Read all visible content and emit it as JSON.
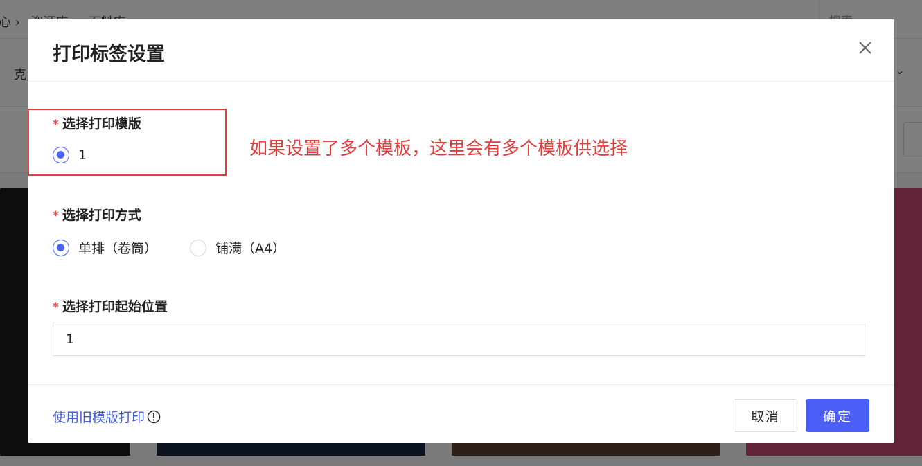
{
  "background": {
    "breadcrumb": [
      "心 ›",
      "资源库 ›",
      "面料库"
    ],
    "search_placeholder": "搜索",
    "toolbar_text": "克",
    "card_colors": [
      "#1a1a1a",
      "#14233f",
      "#5a4030",
      "#c4456e"
    ]
  },
  "modal": {
    "title": "打印标签设置",
    "close_icon": "close-icon",
    "template_section": {
      "label": "选择打印模版",
      "required_mark": "*",
      "options": [
        {
          "label": "1",
          "checked": true
        }
      ]
    },
    "annotation": "如果设置了多个模板，这里会有多个模板供选择",
    "method_section": {
      "label": "选择打印方式",
      "required_mark": "*",
      "options": [
        {
          "label": "单排（卷筒）",
          "checked": true
        },
        {
          "label": "铺满（A4）",
          "checked": false
        }
      ]
    },
    "start_section": {
      "label": "选择打印起始位置",
      "required_mark": "*",
      "value": "1"
    },
    "footer": {
      "old_print_link": "使用旧模版打印",
      "info_icon": "info-icon",
      "cancel_label": "取消",
      "ok_label": "确定"
    }
  },
  "colors": {
    "accent": "#4b5ef5",
    "required": "#f04b4b",
    "annotation": "#e53b3b",
    "link": "#3f5ad8"
  }
}
